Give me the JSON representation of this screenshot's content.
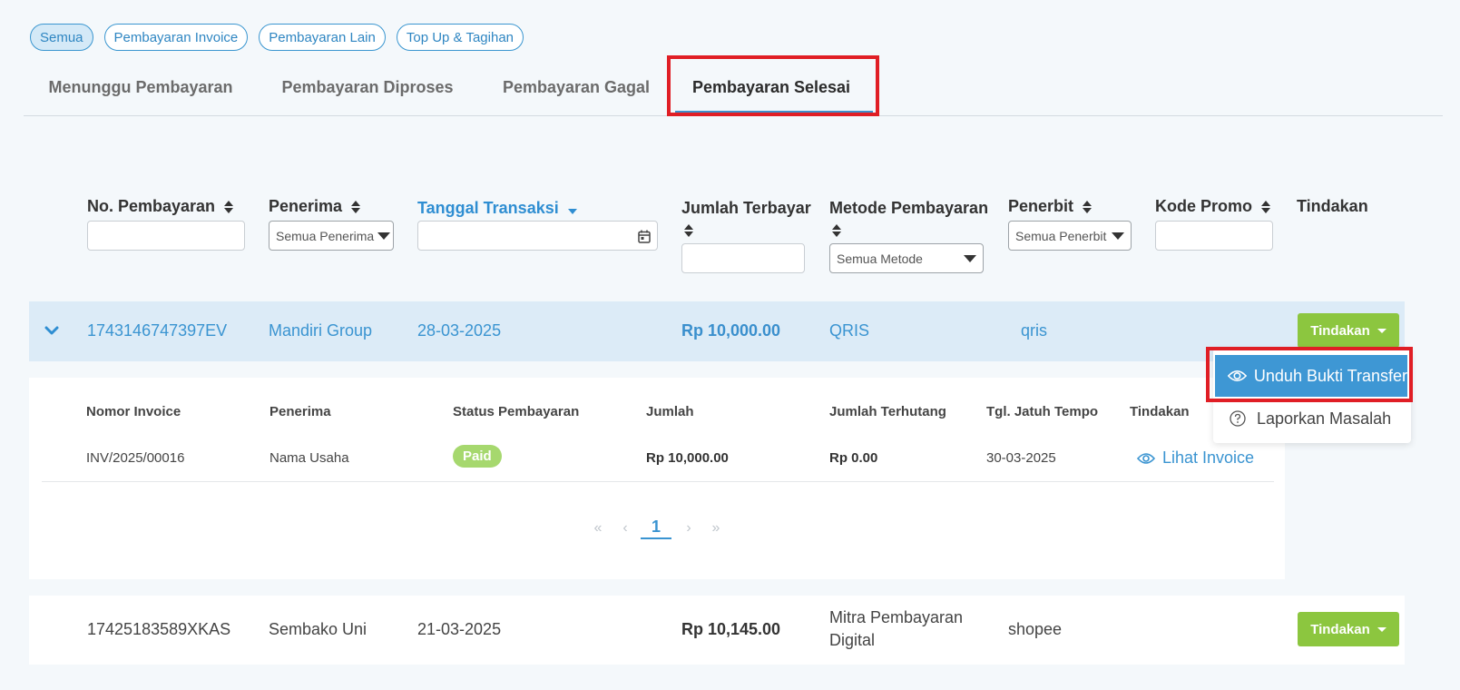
{
  "type_filters": [
    "Semua",
    "Pembayaran Invoice",
    "Pembayaran Lain",
    "Top Up & Tagihan"
  ],
  "status_tabs": [
    "Menunggu Pembayaran",
    "Pembayaran Diproses",
    "Pembayaran Gagal",
    "Pembayaran Selesai"
  ],
  "active_status_tab": "Pembayaran Selesai",
  "columns": {
    "no_pembayaran": "No. Pembayaran",
    "penerima": "Penerima",
    "tanggal_transaksi": "Tanggal Transaksi",
    "jumlah_terbayar": "Jumlah Terbayar",
    "metode_pembayaran": "Metode Pembayaran",
    "penerbit": "Penerbit",
    "kode_promo": "Kode Promo",
    "tindakan": "Tindakan"
  },
  "filters": {
    "penerima_selected": "Semua Penerima",
    "metode_selected": "Semua Metode",
    "penerbit_selected": "Semua Penerbit"
  },
  "rows": [
    {
      "no_pembayaran": "1743146747397EV",
      "penerima": "Mandiri Group",
      "tanggal": "28-03-2025",
      "jumlah": "Rp 10,000.00",
      "metode": "QRIS",
      "penerbit": "qris",
      "action_label": "Tindakan"
    },
    {
      "no_pembayaran": "17425183589XKAS",
      "penerima": "Sembako Uni",
      "tanggal": "21-03-2025",
      "jumlah": "Rp 10,145.00",
      "metode": "Mitra Pembayaran Digital",
      "penerbit": "shopee",
      "action_label": "Tindakan"
    }
  ],
  "detail": {
    "headers": {
      "nomor_invoice": "Nomor Invoice",
      "penerima": "Penerima",
      "status_pembayaran": "Status Pembayaran",
      "jumlah": "Jumlah",
      "jumlah_terhutang": "Jumlah Terhutang",
      "tgl_jatuh_tempo": "Tgl. Jatuh Tempo",
      "tindakan": "Tindakan"
    },
    "row": {
      "nomor_invoice": "INV/2025/00016",
      "penerima": "Nama Usaha",
      "status": "Paid",
      "jumlah": "Rp 10,000.00",
      "jumlah_terhutang": "Rp 0.00",
      "tgl_jatuh_tempo": "30-03-2025",
      "link_label": "Lihat Invoice"
    },
    "pagination": {
      "first": "«",
      "prev": "‹",
      "current": "1",
      "next": "›",
      "last": "»"
    }
  },
  "dropdown": {
    "items": [
      "Unduh Bukti Transfer",
      "Laporkan Masalah"
    ]
  },
  "colors": {
    "accent_blue": "#3a94d1",
    "action_green": "#8cc63f",
    "highlight_red": "#e01e25",
    "paid_badge": "#a6d86e"
  }
}
